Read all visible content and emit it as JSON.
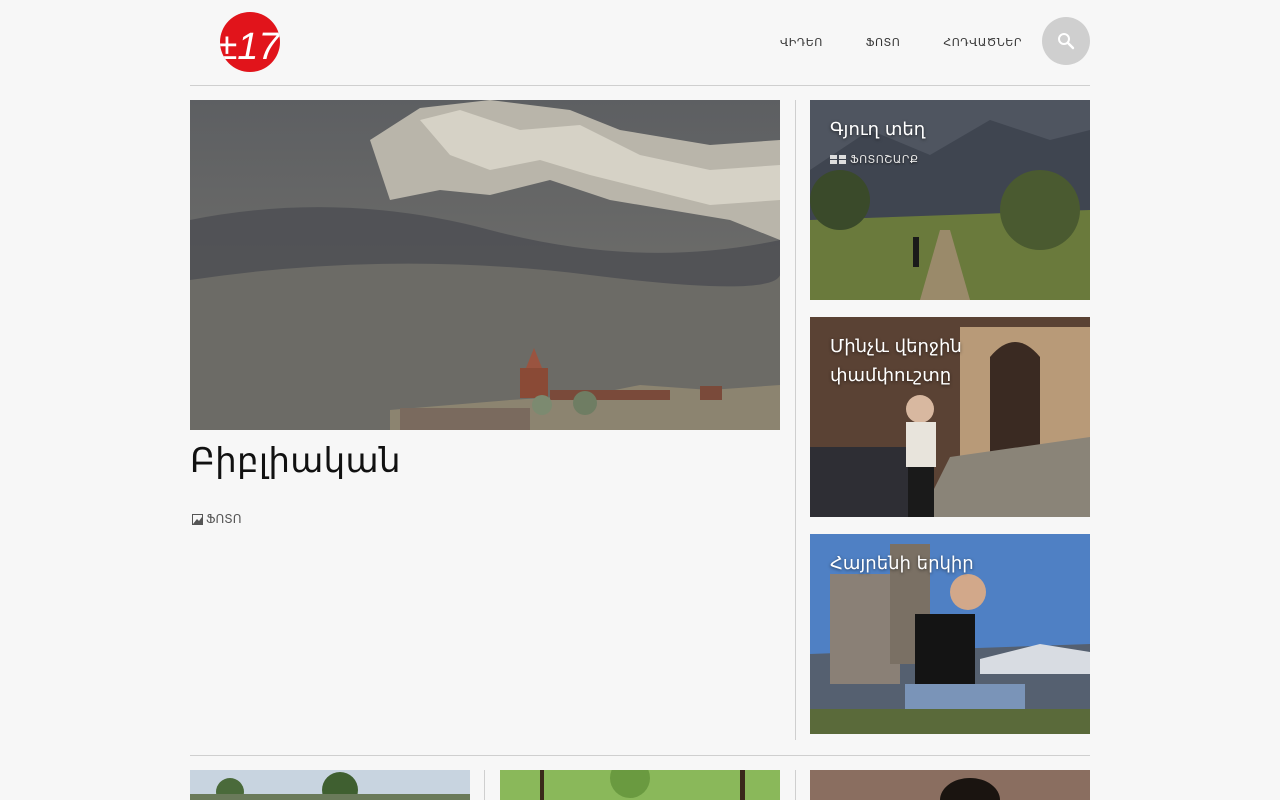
{
  "header": {
    "logo_text": "±17",
    "nav": [
      {
        "label": "ՎԻԴԵՈ"
      },
      {
        "label": "ՖՈՏՈ"
      },
      {
        "label": "ՀՈԴՎԱԾՆԵՐ"
      }
    ],
    "search_icon": "search-icon"
  },
  "feature": {
    "title": "Բիբլիական",
    "category": "ՖՈՏՈ",
    "category_icon": "photo-icon"
  },
  "cards": [
    {
      "title": "Գյուղ տեղ",
      "category": "ՖՈՏՈՇԱՐՔ",
      "category_icon": "gallery-icon"
    },
    {
      "title": "Մինչև վերջին փամփուշտը"
    },
    {
      "title": "Հայրենի երկիր"
    }
  ],
  "colors": {
    "logo_red": "#e1141b",
    "background": "#f7f7f7",
    "divider": "#cfcfcf"
  }
}
